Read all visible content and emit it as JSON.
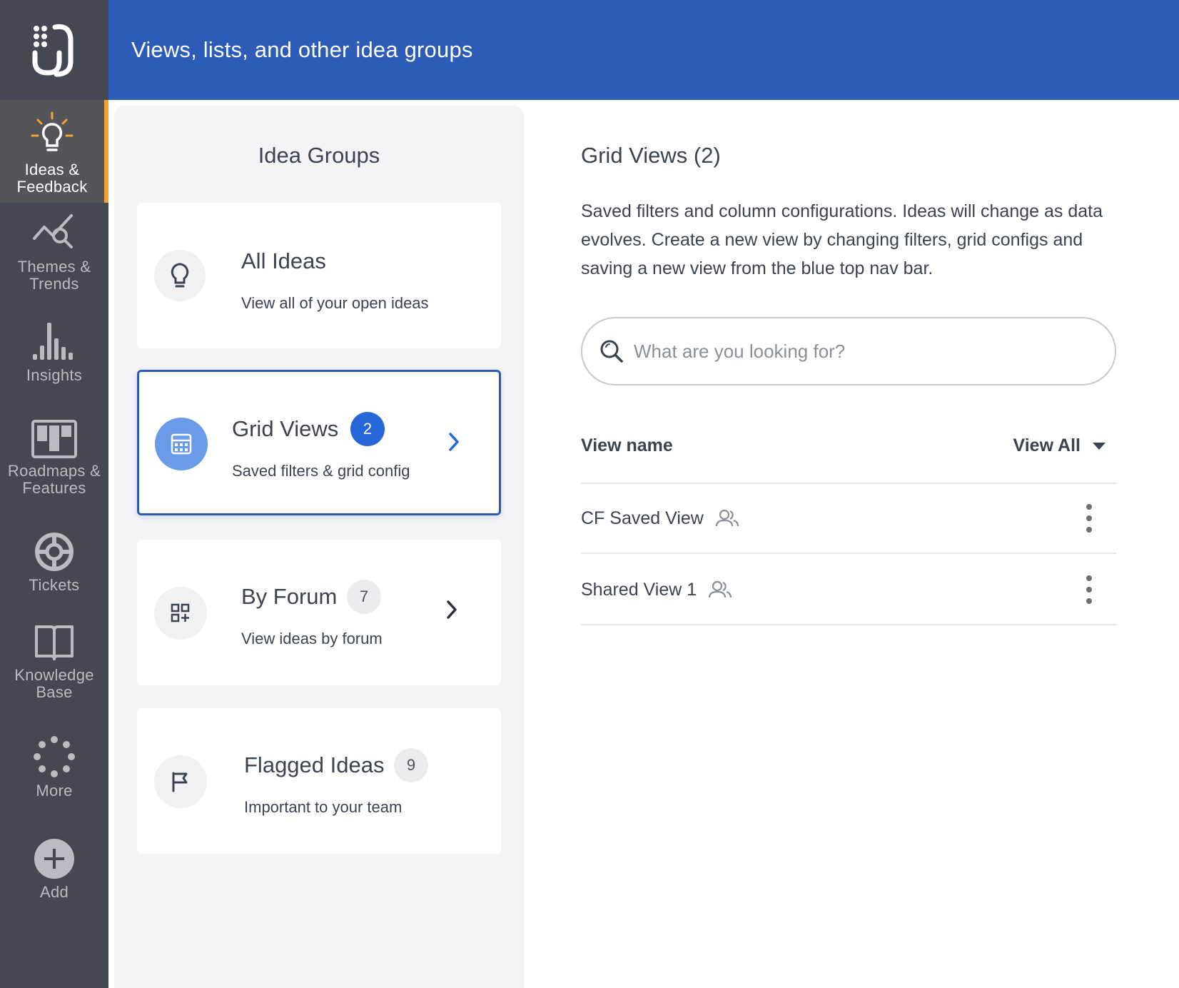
{
  "header": {
    "title": "Views, lists, and other idea groups"
  },
  "nav": {
    "items": [
      {
        "label": "Ideas &\nFeedback",
        "icon": "lightbulb-icon",
        "active": true
      },
      {
        "label": "Themes &\nTrends",
        "icon": "trend-search-icon"
      },
      {
        "label": "Insights",
        "icon": "bar-chart-icon"
      },
      {
        "label": "Roadmaps &\nFeatures",
        "icon": "roadmap-icon"
      },
      {
        "label": "Tickets",
        "icon": "lifebuoy-icon"
      },
      {
        "label": "Knowledge\nBase",
        "icon": "book-icon"
      },
      {
        "label": "More",
        "icon": "dots-circle-icon"
      },
      {
        "label": "Add",
        "icon": "plus-icon"
      }
    ],
    "active_accent": "#f4a236"
  },
  "groups": {
    "title": "Idea Groups",
    "cards": [
      {
        "name": "All Ideas",
        "description": "View all of your open ideas",
        "icon": "lightbulb-icon"
      },
      {
        "name": "Grid Views",
        "count": "2",
        "description": "Saved filters & grid config",
        "icon": "grid-calculator-icon",
        "selected": true
      },
      {
        "name": "By Forum",
        "count": "7",
        "description": "View ideas by forum",
        "icon": "apps-add-icon"
      },
      {
        "name": "Flagged Ideas",
        "count": "9",
        "description": "Important to your team",
        "icon": "flag-icon"
      }
    ]
  },
  "content": {
    "title": "Grid Views (2)",
    "description": "Saved filters and column configurations. Ideas will change as data evolves. Create a new view by changing filters, grid configs and saving a new view from the blue top nav bar.",
    "search_placeholder": "What are you looking for?",
    "column_header": "View name",
    "filter_label": "View All",
    "views": [
      {
        "name": "CF Saved View",
        "shared": true
      },
      {
        "name": "Shared View 1",
        "shared": true
      }
    ]
  },
  "colors": {
    "header_blue": "#2c5cb8",
    "rail": "#444852",
    "badge_blue": "#2766d8"
  }
}
